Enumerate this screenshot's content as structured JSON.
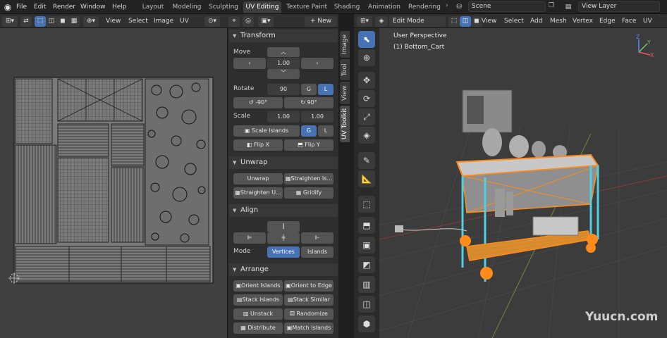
{
  "topbar": {
    "menus": [
      "File",
      "Edit",
      "Render",
      "Window",
      "Help"
    ],
    "workspaces": [
      "Layout",
      "Modeling",
      "Sculpting",
      "UV Editing",
      "Texture Paint",
      "Shading",
      "Animation",
      "Rendering"
    ],
    "active_workspace": "UV Editing",
    "scene": "Scene",
    "view_layer": "View Layer"
  },
  "uv_header": {
    "menus": [
      "View",
      "Select",
      "Image",
      "UV"
    ],
    "new_label": "+ New"
  },
  "npanel": {
    "tabs": [
      "Image",
      "Tool",
      "View",
      "UV Toolkit"
    ],
    "transform": {
      "title": "Transform",
      "move_label": "Move",
      "move_value": "1.00",
      "rotate_label": "Rotate",
      "rotate_value": "90",
      "g": "G",
      "l": "L",
      "rot_minus": "-90°",
      "rot_plus": "90°",
      "scale_label": "Scale",
      "scale_x": "1.00",
      "scale_y": "1.00",
      "scale_islands": "Scale Islands",
      "flip_x": "Flip X",
      "flip_y": "Flip Y"
    },
    "unwrap": {
      "title": "Unwrap",
      "unwrap": "Unwrap",
      "straighten_island": "Straighten Is...",
      "straighten_uv": "Straighten U...",
      "gridify": "Gridify"
    },
    "align": {
      "title": "Align",
      "mode_label": "Mode",
      "vertices": "Vertices",
      "islands": "Islands"
    },
    "arrange": {
      "title": "Arrange",
      "orient_islands": "Orient Islands",
      "orient_edge": "Orient to Edge",
      "stack_islands": "Stack Islands",
      "stack_similar": "Stack Similar",
      "unstack": "Unstack",
      "randomize": "Randomize",
      "distribute": "Distribute",
      "match_islands": "Match Islands"
    }
  },
  "viewport_header": {
    "mode": "Edit Mode",
    "menus": [
      "View",
      "Select",
      "Add",
      "Mesh",
      "Vertex",
      "Edge",
      "Face",
      "UV"
    ]
  },
  "viewport": {
    "perspective": "User Perspective",
    "object": "(1) Bottom_Cart",
    "axis_x": "X",
    "axis_y": "Y",
    "axis_z": "Z"
  },
  "watermark": "Yuucn.com",
  "colors": {
    "accent": "#4772b3",
    "selection": "#ff8c1a",
    "edge_highlight": "#4dd0e1"
  }
}
